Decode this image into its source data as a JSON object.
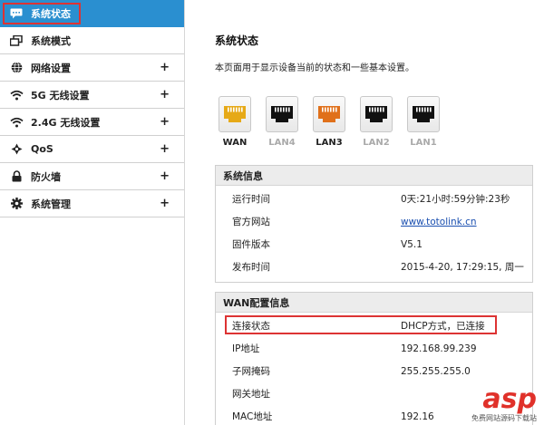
{
  "sidebar": {
    "items": [
      {
        "label": "系统状态",
        "icon": "chat-icon",
        "active": true,
        "expandable": false
      },
      {
        "label": "系统模式",
        "icon": "windows-icon",
        "active": false,
        "expandable": false
      },
      {
        "label": "网络设置",
        "icon": "globe-icon",
        "active": false,
        "expandable": true
      },
      {
        "label": "5G 无线设置",
        "icon": "wifi-icon",
        "active": false,
        "expandable": true
      },
      {
        "label": "2.4G 无线设置",
        "icon": "wifi-icon",
        "active": false,
        "expandable": true
      },
      {
        "label": "QoS",
        "icon": "qos-icon",
        "active": false,
        "expandable": true
      },
      {
        "label": "防火墙",
        "icon": "lock-icon",
        "active": false,
        "expandable": true
      },
      {
        "label": "系统管理",
        "icon": "gear-icon",
        "active": false,
        "expandable": true
      }
    ],
    "plus": "+"
  },
  "main": {
    "title": "系统状态",
    "description": "本页面用于显示设备当前的状态和一些基本设置。",
    "ports": [
      {
        "label": "WAN",
        "connected": true,
        "color": "#e6a917"
      },
      {
        "label": "LAN4",
        "connected": false,
        "color": "#111111"
      },
      {
        "label": "LAN3",
        "connected": true,
        "color": "#e0701a"
      },
      {
        "label": "LAN2",
        "connected": false,
        "color": "#111111"
      },
      {
        "label": "LAN1",
        "connected": false,
        "color": "#111111"
      }
    ],
    "system_info": {
      "header": "系统信息",
      "rows": [
        {
          "key": "运行时间",
          "value": "0天:21小时:59分钟:23秒"
        },
        {
          "key": "官方网站",
          "value": "www.totolink.cn"
        },
        {
          "key": "固件版本",
          "value": "V5.1"
        },
        {
          "key": "发布时间",
          "value": "2015-4-20, 17:29:15, 周一"
        }
      ]
    },
    "wan_info": {
      "header": "WAN配置信息",
      "rows": [
        {
          "key": "连接状态",
          "value": "DHCP方式，已连接"
        },
        {
          "key": "IP地址",
          "value": "192.168.99.239"
        },
        {
          "key": "子网掩码",
          "value": "255.255.255.0"
        },
        {
          "key": "网关地址",
          "value": ""
        },
        {
          "key": "MAC地址",
          "value": "192.16"
        }
      ]
    }
  },
  "watermark": {
    "logo": "asp",
    "sub": "免费网站源码下载站"
  },
  "colors": {
    "accent": "#2a8fd0",
    "highlight": "#dd3333",
    "link": "#1a4fb0"
  }
}
